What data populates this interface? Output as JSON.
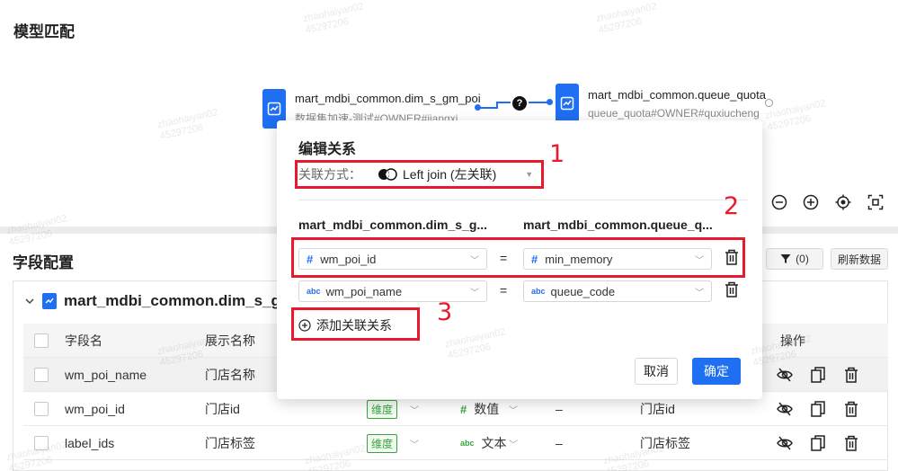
{
  "top_section": {
    "title": "模型匹配",
    "left_node": {
      "title": "mart_mdbi_common.dim_s_gm_poi",
      "subtitle": "数据集加速-测试#OWNER#jiangxi..."
    },
    "right_node": {
      "title": "mart_mdbi_common.queue_quota",
      "subtitle": "queue_quota#OWNER#quxiucheng"
    },
    "join_indicator": "?",
    "zoom_controls": [
      "zoom-out-icon",
      "zoom-in-icon",
      "locate-icon",
      "fit-screen-icon"
    ]
  },
  "bottom_section": {
    "title": "字段配置",
    "filter_button": "(0)",
    "refresh_button": "刷新数据",
    "table_title": "mart_mdbi_common.dim_s_gm",
    "columns": {
      "field_name": "字段名",
      "display_name": "展示名称",
      "actions": "操作"
    },
    "rows": [
      {
        "field_name": "wm_poi_name",
        "display_name": "门店名称"
      },
      {
        "field_name": "wm_poi_id",
        "display_name": "门店id",
        "role": "维度",
        "type": "数值",
        "default": "–",
        "desc": "门店id"
      },
      {
        "field_name": "label_ids",
        "display_name": "门店标签",
        "role": "维度",
        "type": "文本",
        "default": "–",
        "desc": "门店标签"
      }
    ]
  },
  "modal": {
    "title": "编辑关系",
    "join_label": "关联方式：",
    "join_value": "Left join (左关联)",
    "left_table": "mart_mdbi_common.dim_s_g...",
    "right_table": "mart_mdbi_common.queue_q...",
    "equals": "=",
    "relations": [
      {
        "left_type": "#",
        "left_field": "wm_poi_id",
        "right_type": "#",
        "right_field": "min_memory"
      },
      {
        "left_type": "abc",
        "left_field": "wm_poi_name",
        "right_type": "abc",
        "right_field": "queue_code"
      }
    ],
    "add_relation": "添加关联关系",
    "cancel": "取消",
    "confirm": "确定"
  },
  "annotations": [
    "1",
    "2",
    "3"
  ],
  "watermark": {
    "name": "zhaohaiyan02",
    "id": "45297206"
  },
  "colors": {
    "accent": "#1f6ff2",
    "annotation": "#e8192c",
    "dimension_tag": "#39a33c"
  }
}
